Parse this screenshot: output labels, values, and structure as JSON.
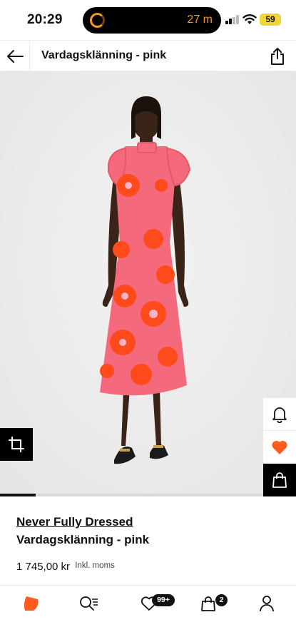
{
  "status_bar": {
    "time": "20:29",
    "activity_timer": "27 m",
    "battery": "59"
  },
  "header": {
    "title": "Vardagsklänning - pink"
  },
  "product_image": {
    "alt": "Model wearing pink dress with orange sun print",
    "carousel_position": 0.12
  },
  "product": {
    "brand": "Never Fully Dressed",
    "name": "Vardagsklänning - pink",
    "price": "1 745,00 kr",
    "price_note": "Inkl. moms"
  },
  "bottom_nav": {
    "favorites_badge": "99+",
    "bag_badge": "2"
  },
  "colors": {
    "accent": "#ff5a1f",
    "heart": "#ff5a1f",
    "dress": "#f46a7c",
    "background_image": "#ececec"
  }
}
